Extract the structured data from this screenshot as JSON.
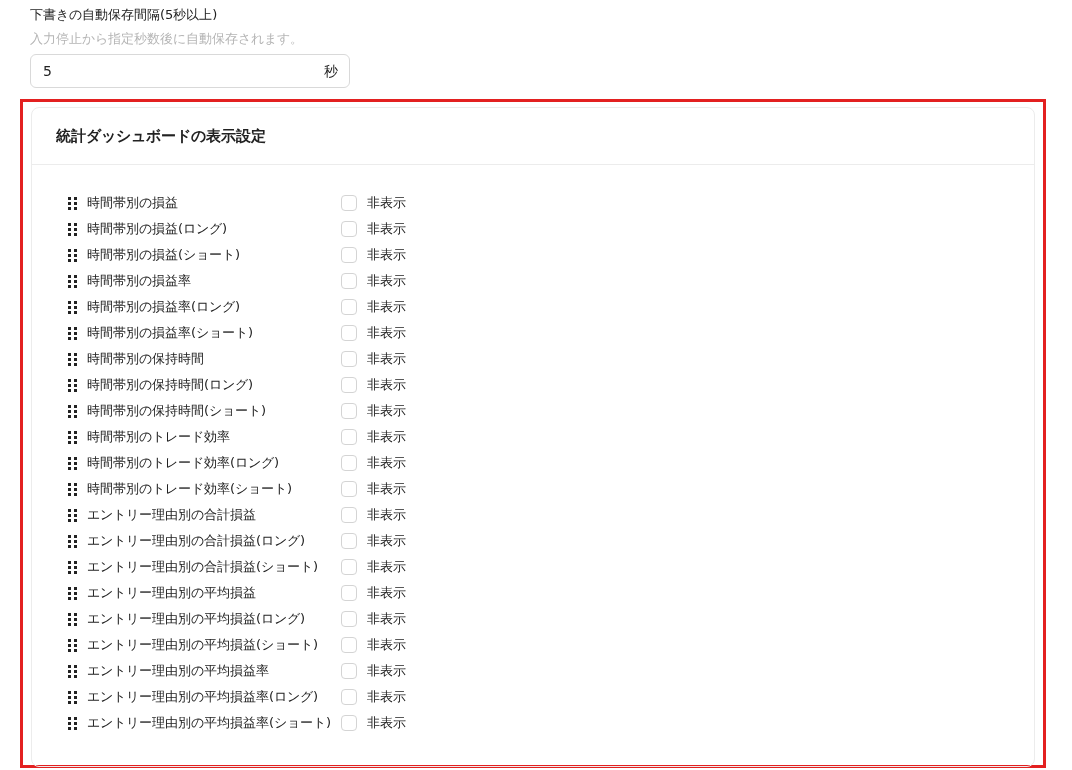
{
  "autosave": {
    "label": "下書きの自動保存間隔(5秒以上)",
    "hint": "入力停止から指定秒数後に自動保存されます。",
    "value": "5",
    "unit": "秒"
  },
  "dashboard": {
    "title": "統計ダッシュボードの表示設定",
    "items": [
      {
        "label": "時間帯別の損益",
        "checkbox_label": "非表示",
        "checked": false
      },
      {
        "label": "時間帯別の損益(ロング)",
        "checkbox_label": "非表示",
        "checked": false
      },
      {
        "label": "時間帯別の損益(ショート)",
        "checkbox_label": "非表示",
        "checked": false
      },
      {
        "label": "時間帯別の損益率",
        "checkbox_label": "非表示",
        "checked": false
      },
      {
        "label": "時間帯別の損益率(ロング)",
        "checkbox_label": "非表示",
        "checked": false
      },
      {
        "label": "時間帯別の損益率(ショート)",
        "checkbox_label": "非表示",
        "checked": false
      },
      {
        "label": "時間帯別の保持時間",
        "checkbox_label": "非表示",
        "checked": false
      },
      {
        "label": "時間帯別の保持時間(ロング)",
        "checkbox_label": "非表示",
        "checked": false
      },
      {
        "label": "時間帯別の保持時間(ショート)",
        "checkbox_label": "非表示",
        "checked": false
      },
      {
        "label": "時間帯別のトレード効率",
        "checkbox_label": "非表示",
        "checked": false
      },
      {
        "label": "時間帯別のトレード効率(ロング)",
        "checkbox_label": "非表示",
        "checked": false
      },
      {
        "label": "時間帯別のトレード効率(ショート)",
        "checkbox_label": "非表示",
        "checked": false
      },
      {
        "label": "エントリー理由別の合計損益",
        "checkbox_label": "非表示",
        "checked": false
      },
      {
        "label": "エントリー理由別の合計損益(ロング)",
        "checkbox_label": "非表示",
        "checked": false
      },
      {
        "label": "エントリー理由別の合計損益(ショート)",
        "checkbox_label": "非表示",
        "checked": false
      },
      {
        "label": "エントリー理由別の平均損益",
        "checkbox_label": "非表示",
        "checked": false
      },
      {
        "label": "エントリー理由別の平均損益(ロング)",
        "checkbox_label": "非表示",
        "checked": false
      },
      {
        "label": "エントリー理由別の平均損益(ショート)",
        "checkbox_label": "非表示",
        "checked": false
      },
      {
        "label": "エントリー理由別の平均損益率",
        "checkbox_label": "非表示",
        "checked": false
      },
      {
        "label": "エントリー理由別の平均損益率(ロング)",
        "checkbox_label": "非表示",
        "checked": false
      },
      {
        "label": "エントリー理由別の平均損益率(ショート)",
        "checkbox_label": "非表示",
        "checked": false
      }
    ]
  }
}
